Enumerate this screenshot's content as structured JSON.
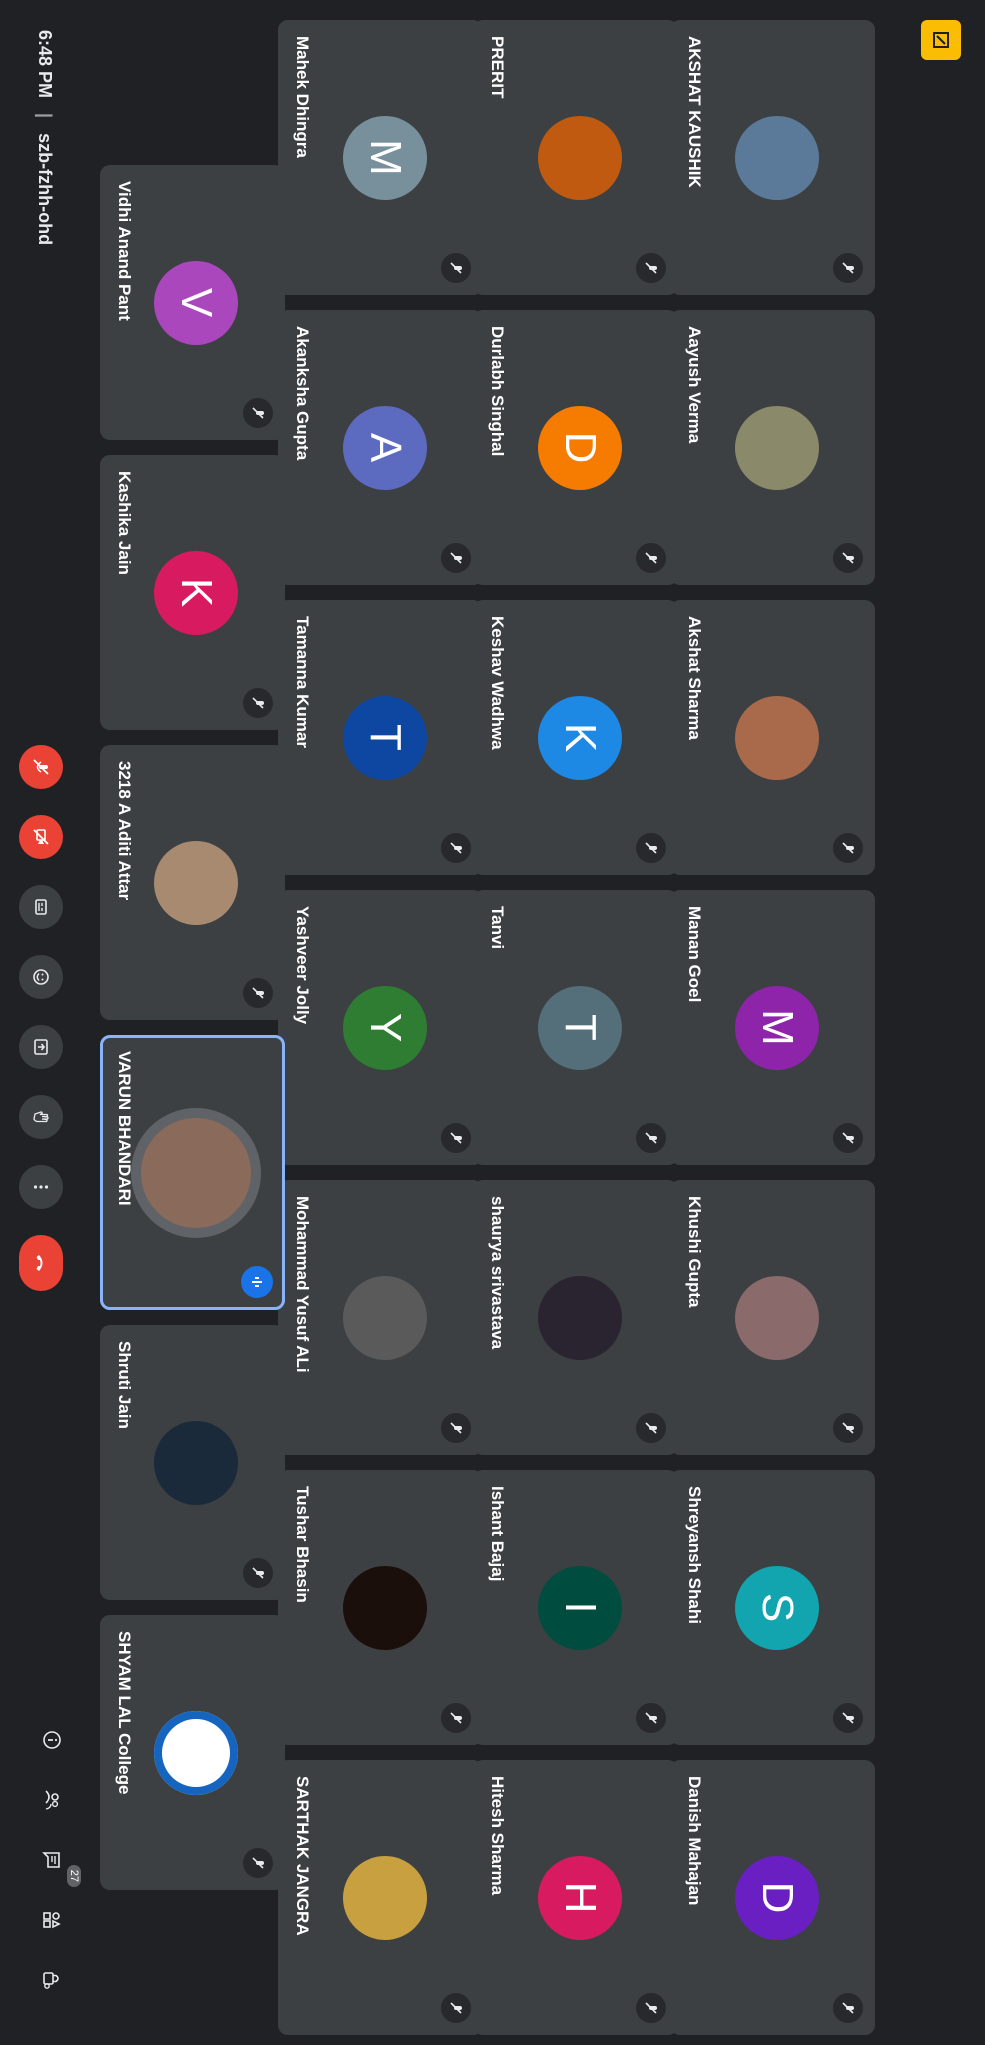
{
  "meeting": {
    "time": "6:48 PM",
    "separator": "|",
    "code": "szb-fzhh-ohd"
  },
  "participant_count": "27",
  "tiles": [
    {
      "name": "AKSHAT KAUSHIK",
      "initial": "",
      "color": "#5b7a9a",
      "photo": true
    },
    {
      "name": "Aayush Verma",
      "initial": "",
      "color": "#8a8a6a",
      "photo": true
    },
    {
      "name": "Akshat Sharma",
      "initial": "",
      "color": "#a86a4a",
      "photo": true
    },
    {
      "name": "Manan Goel",
      "initial": "M",
      "color": "#8e24aa",
      "photo": false
    },
    {
      "name": "Khushi Gupta",
      "initial": "",
      "color": "#8a6a6a",
      "photo": true
    },
    {
      "name": "Shreyansh Shahi",
      "initial": "S",
      "color": "#12a4af",
      "photo": false
    },
    {
      "name": "Danish Mahajan",
      "initial": "D",
      "color": "#6a1fc2",
      "photo": false
    },
    {
      "name": "PRERIT",
      "initial": "",
      "color": "#c05a10",
      "photo": true
    },
    {
      "name": "Durlabh Singhal",
      "initial": "D",
      "color": "#f57c00",
      "photo": false
    },
    {
      "name": "Keshav Wadhwa",
      "initial": "K",
      "color": "#1e88e5",
      "photo": false
    },
    {
      "name": "Tanvi",
      "initial": "T",
      "color": "#546e7a",
      "photo": false
    },
    {
      "name": "shaurya srivastava",
      "initial": "",
      "color": "#2a2430",
      "photo": true
    },
    {
      "name": "Ishant Bajaj",
      "initial": "I",
      "color": "#004d40",
      "photo": false
    },
    {
      "name": "Hitesh Sharma",
      "initial": "H",
      "color": "#d81b60",
      "photo": false
    },
    {
      "name": "Mahek Dhingra",
      "initial": "M",
      "color": "#78909c",
      "photo": false
    },
    {
      "name": "Akanksha Gupta",
      "initial": "A",
      "color": "#5c6bc0",
      "photo": false
    },
    {
      "name": "Tamanna Kumar",
      "initial": "T",
      "color": "#0d47a1",
      "photo": false
    },
    {
      "name": "Yashveer Jolly",
      "initial": "Y",
      "color": "#2e7d32",
      "photo": false
    },
    {
      "name": "Mohammad Yusuf ALi",
      "initial": "",
      "color": "#5a5a5a",
      "photo": true
    },
    {
      "name": "Tushar Bhasin",
      "initial": "",
      "color": "#1a0f0a",
      "photo": true
    },
    {
      "name": "SARTHAK JANGRA",
      "initial": "",
      "color": "#c8a040",
      "photo": true
    },
    {
      "name": "Vidhi Anand Pant",
      "initial": "V",
      "color": "#ab47bc",
      "photo": false
    },
    {
      "name": "Kashika Jain",
      "initial": "K",
      "color": "#d81b60",
      "photo": false
    },
    {
      "name": "3218 A Aditi Attar",
      "initial": "",
      "color": "#a88a70",
      "photo": true
    },
    {
      "name": "VARUN BHANDARI",
      "initial": "",
      "color": "#8a6a5a",
      "photo": true,
      "active": true
    },
    {
      "name": "Shruti Jain",
      "initial": "",
      "color": "#1a2a3a",
      "photo": true
    },
    {
      "name": "SHYAM LAL College",
      "initial": "",
      "color": "#ffffff",
      "photo": true
    }
  ],
  "controls": [
    {
      "name": "mic-off",
      "label": "Microphone off"
    },
    {
      "name": "camera-off",
      "label": "Camera off"
    },
    {
      "name": "captions",
      "label": "Captions"
    },
    {
      "name": "emoji",
      "label": "Reactions"
    },
    {
      "name": "present",
      "label": "Present now"
    },
    {
      "name": "raise-hand",
      "label": "Raise hand"
    },
    {
      "name": "more",
      "label": "More options"
    },
    {
      "name": "leave-call",
      "label": "Leave call"
    }
  ],
  "right_controls": [
    "info",
    "people",
    "chat",
    "activities",
    "host-controls"
  ],
  "colors": {
    "background": "#202124",
    "tile": "#3c4043",
    "red": "#ea4335",
    "accent": "#8ab4f8",
    "edit": "#fbbc04"
  }
}
